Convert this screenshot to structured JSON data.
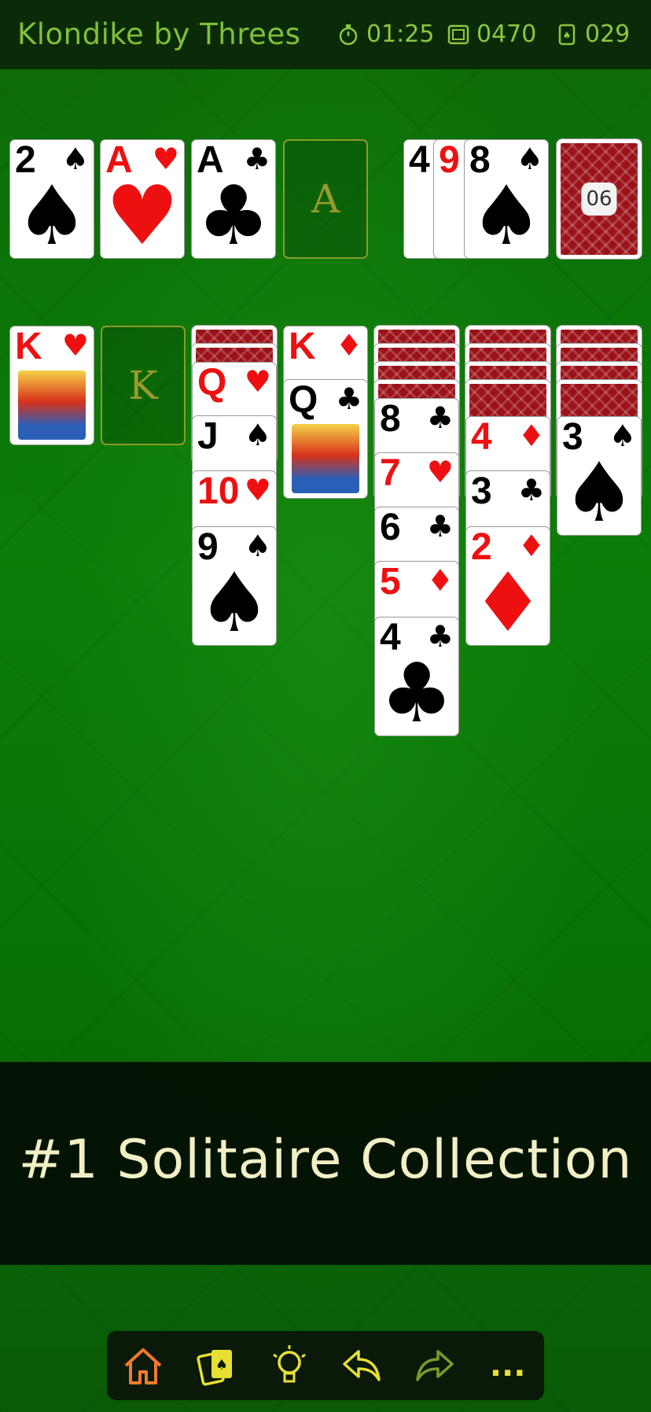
{
  "header": {
    "title": "Klondike by Threes",
    "timer": "01:25",
    "score": "0470",
    "moves": "029"
  },
  "foundations": [
    {
      "rank": "2",
      "suit": "♠",
      "color": "black"
    },
    {
      "rank": "A",
      "suit": "♥",
      "color": "red"
    },
    {
      "rank": "A",
      "suit": "♣",
      "color": "black"
    },
    {
      "empty_label": "A"
    }
  ],
  "waste": [
    {
      "rank": "4",
      "suit": "♠",
      "color": "black"
    },
    {
      "rank": "9",
      "suit": "♥",
      "color": "red"
    },
    {
      "rank": "8",
      "suit": "♠",
      "color": "black"
    }
  ],
  "stock": {
    "count": "06"
  },
  "tableau": [
    {
      "face_down": 0,
      "cards": [
        {
          "rank": "K",
          "suit": "♥",
          "color": "red",
          "face": true
        }
      ]
    },
    {
      "empty_label": "K"
    },
    {
      "face_down": 2,
      "cards": [
        {
          "rank": "Q",
          "suit": "♥",
          "color": "red"
        },
        {
          "rank": "J",
          "suit": "♠",
          "color": "black"
        },
        {
          "rank": "10",
          "suit": "♥",
          "color": "red"
        },
        {
          "rank": "9",
          "suit": "♠",
          "color": "black"
        }
      ]
    },
    {
      "face_down": 0,
      "cards": [
        {
          "rank": "K",
          "suit": "♦",
          "color": "red"
        },
        {
          "rank": "Q",
          "suit": "♣",
          "color": "black",
          "face": true
        }
      ]
    },
    {
      "face_down": 4,
      "cards": [
        {
          "rank": "8",
          "suit": "♣",
          "color": "black"
        },
        {
          "rank": "7",
          "suit": "♥",
          "color": "red"
        },
        {
          "rank": "6",
          "suit": "♣",
          "color": "black"
        },
        {
          "rank": "5",
          "suit": "♦",
          "color": "red"
        },
        {
          "rank": "4",
          "suit": "♣",
          "color": "black"
        }
      ]
    },
    {
      "face_down": 4,
      "cards": [
        {
          "rank": "4",
          "suit": "♦",
          "color": "red"
        },
        {
          "rank": "3",
          "suit": "♣",
          "color": "black"
        },
        {
          "rank": "2",
          "suit": "♦",
          "color": "red"
        }
      ]
    },
    {
      "face_down": 4,
      "cards": [
        {
          "rank": "3",
          "suit": "♠",
          "color": "black"
        }
      ]
    }
  ],
  "banner": {
    "text": "#1 Solitaire Collection"
  },
  "toolbar": {
    "icons": [
      "home-icon",
      "cards-icon",
      "hint-bulb-icon",
      "undo-icon",
      "redo-icon",
      "more-icon"
    ],
    "more_label": "..."
  },
  "colors": {
    "accent": "#8cc640",
    "felt": "#0a7d07",
    "card_back": "#9b1219"
  }
}
